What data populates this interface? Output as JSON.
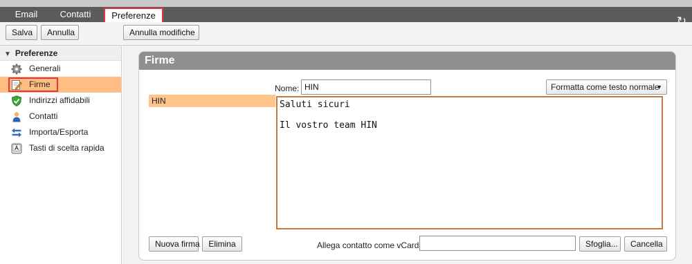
{
  "tabs": {
    "email": "Email",
    "contatti": "Contatti",
    "preferenze": "Preferenze"
  },
  "toolbar": {
    "save_label": "Salva",
    "cancel_label": "Annulla",
    "undo_label": "Annulla modifiche"
  },
  "sidebar": {
    "header": "Preferenze",
    "items": [
      {
        "label": "Generali",
        "icon": "gear-icon"
      },
      {
        "label": "Firme",
        "icon": "signature-icon",
        "selected": true
      },
      {
        "label": "Indirizzi affidabili",
        "icon": "shield-check-icon"
      },
      {
        "label": "Contatti",
        "icon": "person-icon"
      },
      {
        "label": "Importa/Esporta",
        "icon": "import-export-icon"
      },
      {
        "label": "Tasti di scelta rapida",
        "icon": "keyboard-key-icon"
      }
    ]
  },
  "panel": {
    "title": "Firme",
    "name_label": "Nome:",
    "name_value": "HIN",
    "format_label": "Formatta come testo normale",
    "signatures": [
      "HIN"
    ],
    "signature_text": "Saluti sicuri\n\nIl vostro team HIN\n",
    "new_label": "Nuova firma",
    "delete_label": "Elimina",
    "vcard_label": "Allega contatto come vCard:",
    "vcard_value": "",
    "browse_label": "Sfoglia...",
    "cancel_label": "Cancella"
  },
  "colors": {
    "accent_highlight": "#e0393b",
    "selection": "#ffbd84",
    "editor_border": "#c8783d",
    "tabbar": "#5b5b5b"
  }
}
